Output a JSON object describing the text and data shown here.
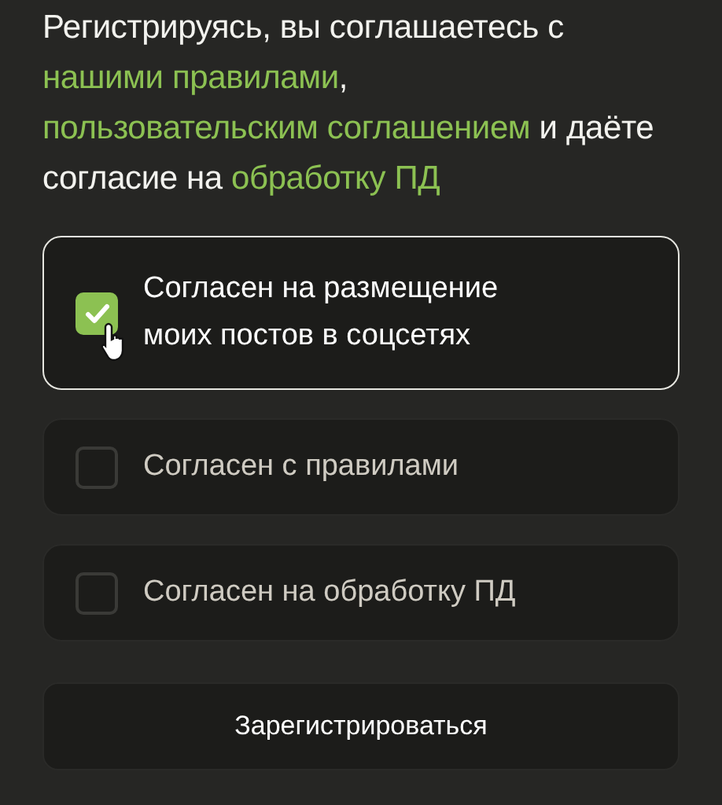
{
  "intro": [
    {
      "kind": "text",
      "text": "Регистрируясь, вы соглашаетесь с "
    },
    {
      "kind": "link",
      "text": "нашими правилами"
    },
    {
      "kind": "text",
      "text": ", "
    },
    {
      "kind": "link",
      "text": "пользовательским соглашением"
    },
    {
      "kind": "text",
      "text": " и даёте согласие на "
    },
    {
      "kind": "link",
      "text": "обработку ПД"
    }
  ],
  "options": [
    {
      "label": "Согласен на размещение моих постов в соцсетях",
      "checked": true,
      "hovered": true
    },
    {
      "label": "Согласен с правилами",
      "checked": false,
      "hovered": false
    },
    {
      "label": "Согласен на обработку ПД",
      "checked": false,
      "hovered": false
    }
  ],
  "submit": {
    "label": "Зарегистрироваться"
  }
}
